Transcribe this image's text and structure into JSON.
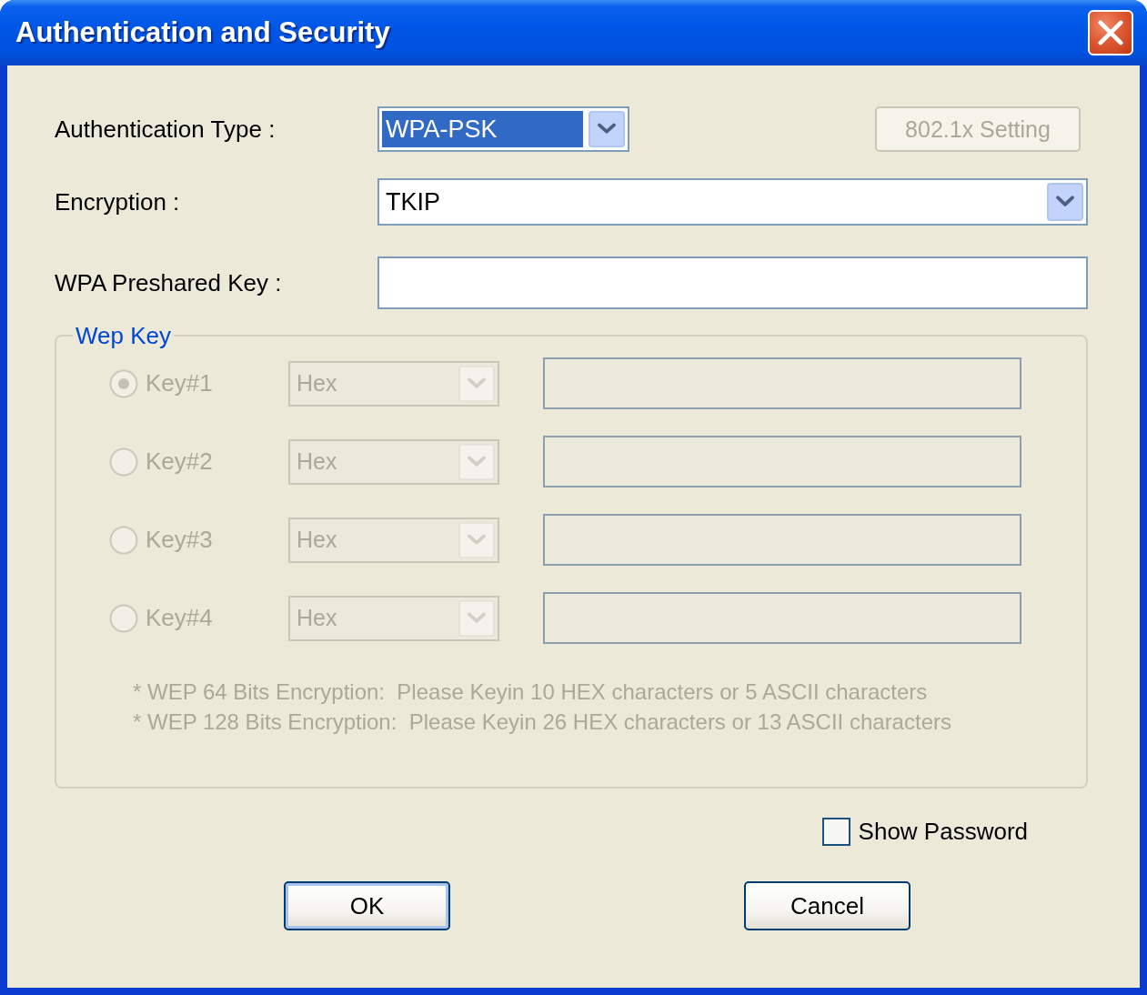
{
  "window": {
    "title": "Authentication and Security"
  },
  "authentication_type": {
    "label": "Authentication Type :",
    "value": "WPA-PSK",
    "focused": true
  },
  "settings_button": {
    "label": "802.1x Setting",
    "disabled": true
  },
  "encryption": {
    "label": "Encryption :",
    "value": "TKIP"
  },
  "preshared_key": {
    "label": "WPA Preshared Key :"
  },
  "wep_key": {
    "title": "Wep Key",
    "disabled": true,
    "keys": [
      {
        "label": "Key#1",
        "selected": true,
        "format": "Hex"
      },
      {
        "label": "Key#2",
        "selected": false,
        "format": "Hex"
      },
      {
        "label": "Key#3",
        "selected": false,
        "format": "Hex"
      },
      {
        "label": "Key#4",
        "selected": false,
        "format": "Hex"
      }
    ],
    "notes": [
      "* WEP 64 Bits Encryption:  Please Keyin 10 HEX characters or 5 ASCII characters",
      "* WEP 128 Bits Encryption:  Please Keyin 26 HEX characters or 13 ASCII characters"
    ]
  },
  "show_password": {
    "label": "Show Password",
    "checked": false
  },
  "buttons": [
    {
      "label": "OK",
      "default": true
    },
    {
      "label": "Cancel",
      "default": false
    }
  ]
}
